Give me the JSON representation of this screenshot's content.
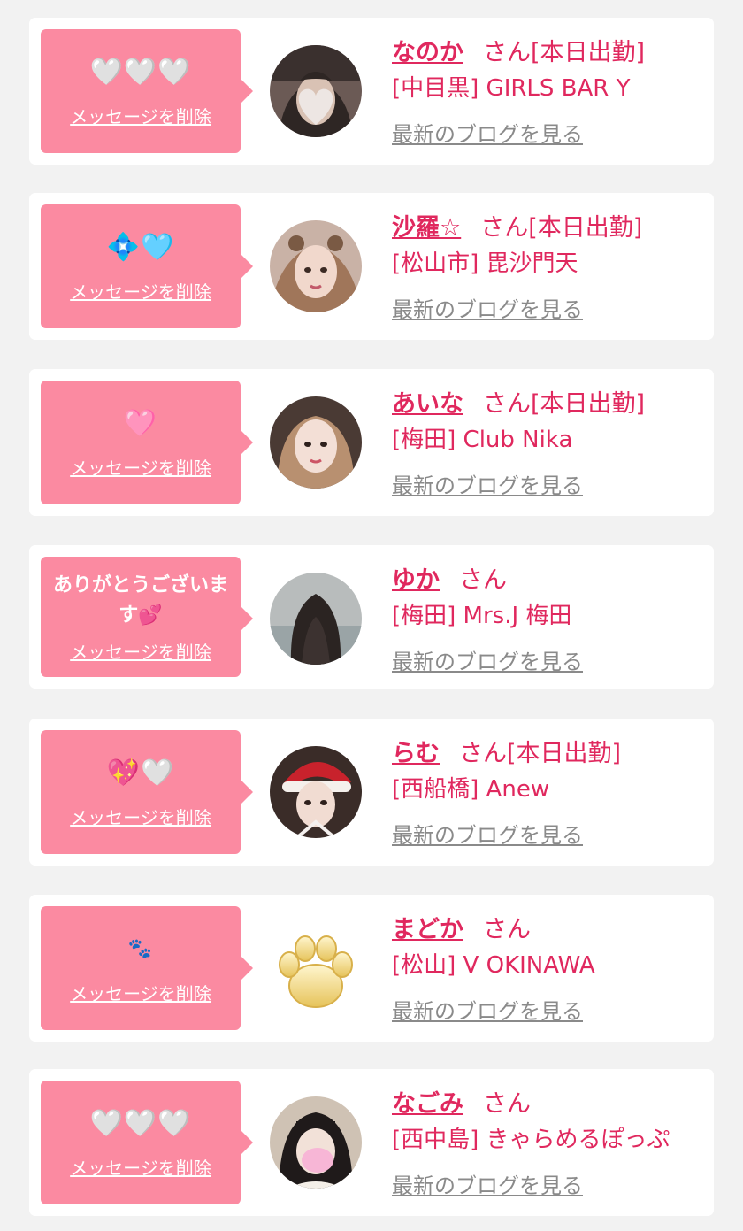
{
  "common": {
    "delete_label": "メッセージを削除",
    "blog_label": "最新のブログを見る",
    "san": "さん"
  },
  "colors": {
    "background": "#f2f2f2",
    "card": "#ffffff",
    "bubble": "#fb8aa1",
    "accent": "#e0285e",
    "link_gray": "#8a8a8a"
  },
  "cards": [
    {
      "message": "🤍🤍🤍",
      "name": "なのか",
      "status": "[本日出勤]",
      "shop": "[中目黒] GIRLS BAR Y",
      "avatar_icon": "avatar-photo-icon"
    },
    {
      "message": "💠🩵",
      "name": "沙羅☆",
      "status": "[本日出勤]",
      "shop": "[松山市] 毘沙門天",
      "avatar_icon": "avatar-photo-icon"
    },
    {
      "message": "🩷",
      "name": "あいな",
      "status": "[本日出勤]",
      "shop": "[梅田] Club Nika",
      "avatar_icon": "avatar-photo-icon"
    },
    {
      "message": "ありがとうございます💕",
      "name": "ゆか",
      "status": "",
      "shop": "[梅田] Mrs.J 梅田",
      "avatar_icon": "avatar-photo-icon"
    },
    {
      "message": "💖🤍",
      "name": "らむ",
      "status": "[本日出勤]",
      "shop": "[西船橋] Anew",
      "avatar_icon": "avatar-photo-icon"
    },
    {
      "message": "🐾",
      "name": "まどか",
      "status": "",
      "shop": "[松山] V OKINAWA",
      "avatar_icon": "paw-icon"
    },
    {
      "message": "🤍🤍🤍",
      "name": "なごみ",
      "status": "",
      "shop": "[西中島] きゃらめるぽっぷ",
      "avatar_icon": "avatar-photo-icon"
    }
  ]
}
